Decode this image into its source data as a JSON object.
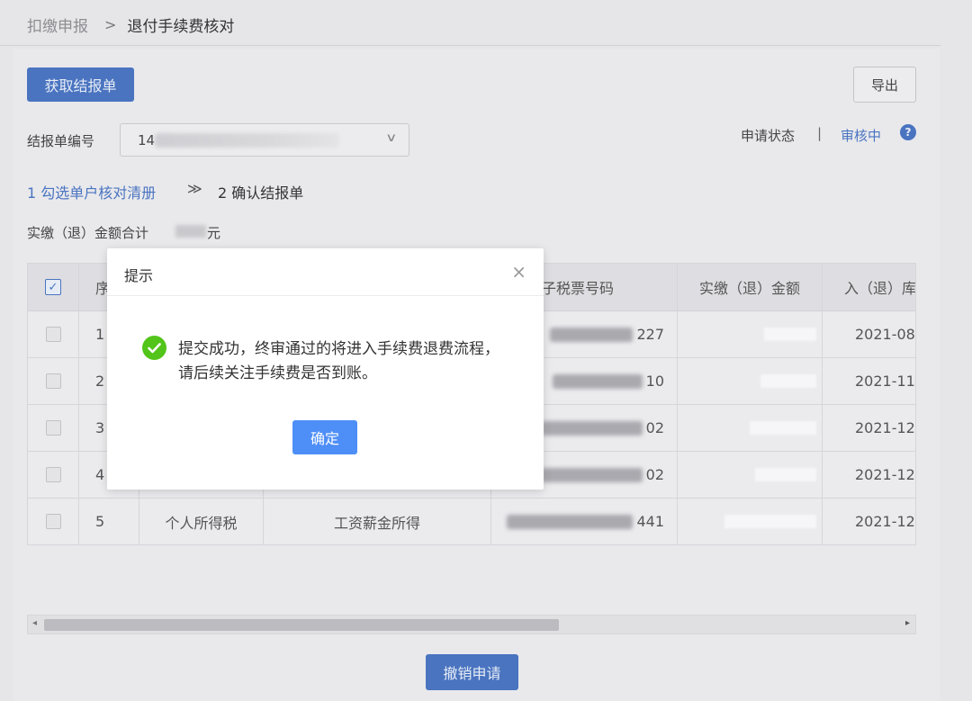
{
  "breadcrumb": {
    "parent": "扣缴申报",
    "separator": ">",
    "current": "退付手续费核对"
  },
  "toolbar": {
    "fetch_label": "获取结报单",
    "export_label": "导出"
  },
  "form": {
    "report_no_label": "结报单编号",
    "report_no_value": "14"
  },
  "status": {
    "label": "申请状态",
    "separator": "|",
    "value": "审核中",
    "help": "?"
  },
  "steps": {
    "step1": "1 勾选单户核对清册",
    "arrow": "≫",
    "step2": "2 确认结报单"
  },
  "summary": {
    "label": "实缴（退）金额合计",
    "unit": "元"
  },
  "table": {
    "headers": {
      "index": "序",
      "ticket": "电子税票号码",
      "amount": "实缴（退）金额",
      "date": "入（退）库"
    },
    "rows": [
      {
        "index": "1",
        "type": "",
        "item": "",
        "ticket_suffix": "227",
        "date": "2021-08-"
      },
      {
        "index": "2",
        "type": "",
        "item": "",
        "ticket_suffix": "10",
        "date": "2021-11-"
      },
      {
        "index": "3",
        "type": "",
        "item": "",
        "ticket_suffix": "02",
        "date": "2021-12-"
      },
      {
        "index": "4",
        "type": "",
        "item": "",
        "ticket_suffix": "02",
        "date": "2021-12-"
      },
      {
        "index": "5",
        "type": "个人所得税",
        "item": "工资薪金所得",
        "ticket_suffix": "441",
        "date": "2021-12-"
      }
    ]
  },
  "footer": {
    "revoke_label": "撤销申请"
  },
  "dialog": {
    "title": "提示",
    "close": "×",
    "message": "提交成功，终审通过的将进入手续费退费流程，请后续关注手续费是否到账。",
    "ok_label": "确定"
  },
  "colors": {
    "primary": "#4a74c0",
    "ok_button": "#4e8ef7",
    "success": "#52c41a"
  }
}
